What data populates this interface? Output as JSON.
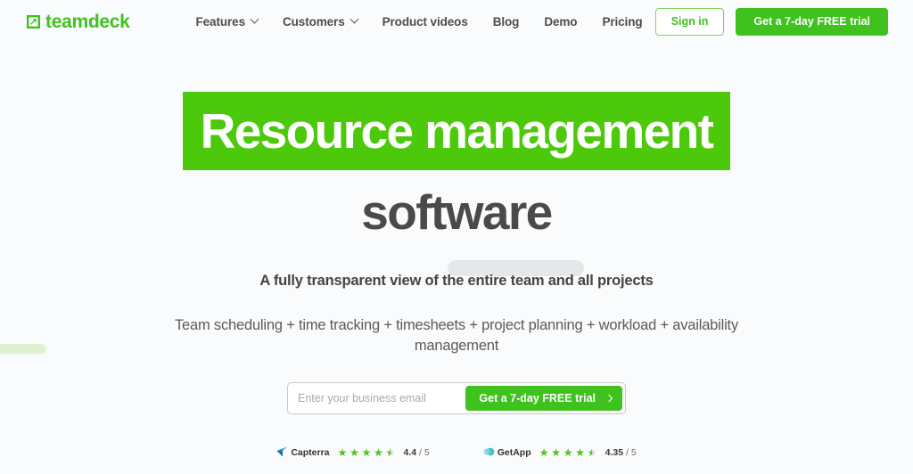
{
  "header": {
    "logo": {
      "text": "teamdeck",
      "icon": "teamdeck-logo-mark",
      "color": "#3fc21e"
    },
    "nav": [
      {
        "label": "Features",
        "has_dropdown": true
      },
      {
        "label": "Customers",
        "has_dropdown": true
      },
      {
        "label": "Product videos",
        "has_dropdown": false
      },
      {
        "label": "Blog",
        "has_dropdown": false
      },
      {
        "label": "Demo",
        "has_dropdown": false
      },
      {
        "label": "Pricing",
        "has_dropdown": false
      }
    ],
    "sign_in_label": "Sign in",
    "trial_label": "Get a 7-day FREE trial"
  },
  "hero": {
    "headline_highlight": "Resource management",
    "headline_rest": "software",
    "highlight_color": "#4dc90b",
    "subtitle": "A fully transparent view of the entire team and all projects",
    "description": "Team scheduling + time tracking + timesheets + project planning + workload + availability management"
  },
  "form": {
    "email_placeholder": "Enter your business email",
    "email_value": "",
    "submit_label": "Get a 7-day FREE trial",
    "submit_icon": "chevron-right-icon"
  },
  "ratings": [
    {
      "brand": "Capterra",
      "brand_icon": "capterra-icon",
      "stars": 4.4,
      "score": "4.4",
      "denominator": "/ 5"
    },
    {
      "brand": "GetApp",
      "brand_icon": "getapp-icon",
      "stars": 4.35,
      "score": "4.35",
      "denominator": "/ 5"
    }
  ],
  "decor": {
    "left_bar_color": "#ddf3cf",
    "gray_pill_color": "#e6e7e8"
  }
}
